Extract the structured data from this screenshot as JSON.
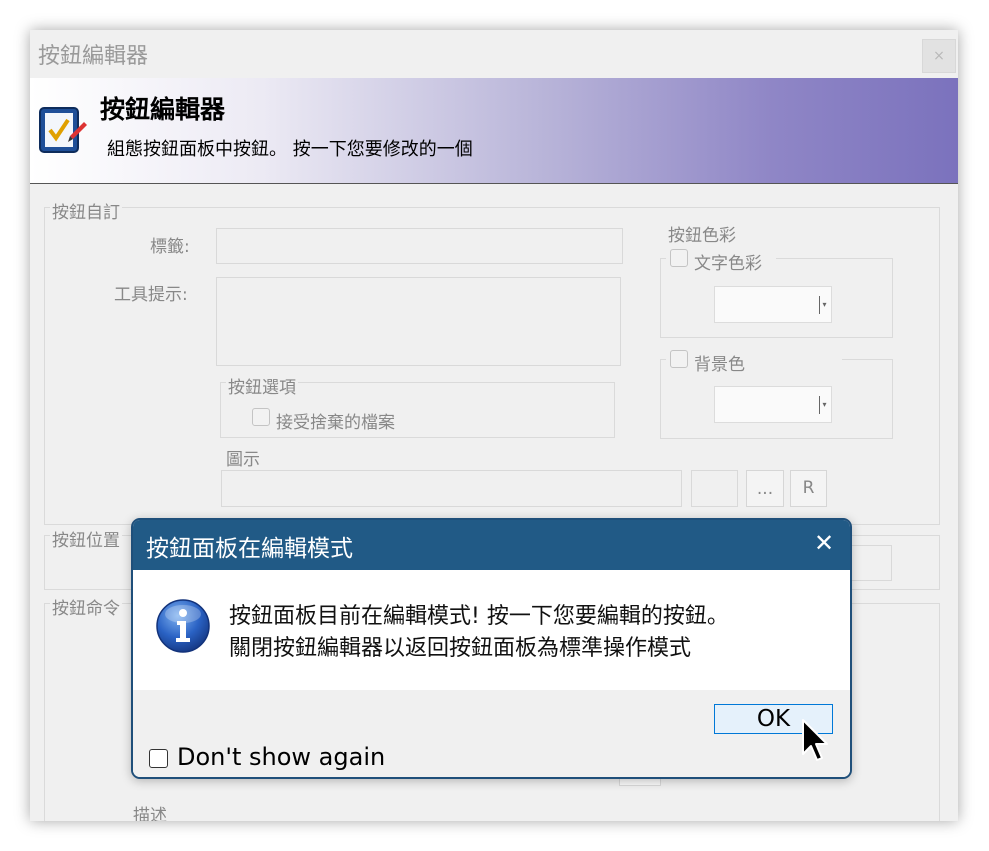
{
  "window": {
    "title": "按鈕編輯器",
    "close_label": "×",
    "banner_title": "按鈕編輯器",
    "banner_subtitle": "組態按鈕面板中按鈕。 按一下您要修改的一個"
  },
  "customize": {
    "group_label": "按鈕自訂",
    "label_field_label": "標籤:",
    "tooltip_field_label": "工具提示:",
    "options_group_label": "按鈕選項",
    "accept_dropped_files_label": "接受捨棄的檔案",
    "icon_label": "圖示",
    "browse_button_label": "...",
    "reset_button_label": "R"
  },
  "colors": {
    "group_label": "按鈕色彩",
    "text_color_label": "文字色彩",
    "background_color_label": "背景色"
  },
  "position": {
    "group_label": "按鈕位置"
  },
  "command": {
    "group_label": "按鈕命令",
    "description_label": "描述"
  },
  "dialog": {
    "title": "按鈕面板在編輯模式",
    "close_label": "✕",
    "message_line1": "按鈕面板目前在編輯模式! 按一下您要編輯的按鈕。",
    "message_line2": "關閉按鈕編輯器以返回按鈕面板為標準操作模式",
    "ok_label": "OK",
    "dont_show_again_label": "Don't show again",
    "dont_show_again_checked": false
  },
  "icons": {
    "banner": "checklist-pen-icon",
    "dialog": "info-icon",
    "cursor": "mouse-pointer-icon"
  },
  "theme": {
    "dialog_header": "#215a86",
    "banner_gradient_end": "#7b72bd",
    "ok_border": "#0078d7"
  }
}
